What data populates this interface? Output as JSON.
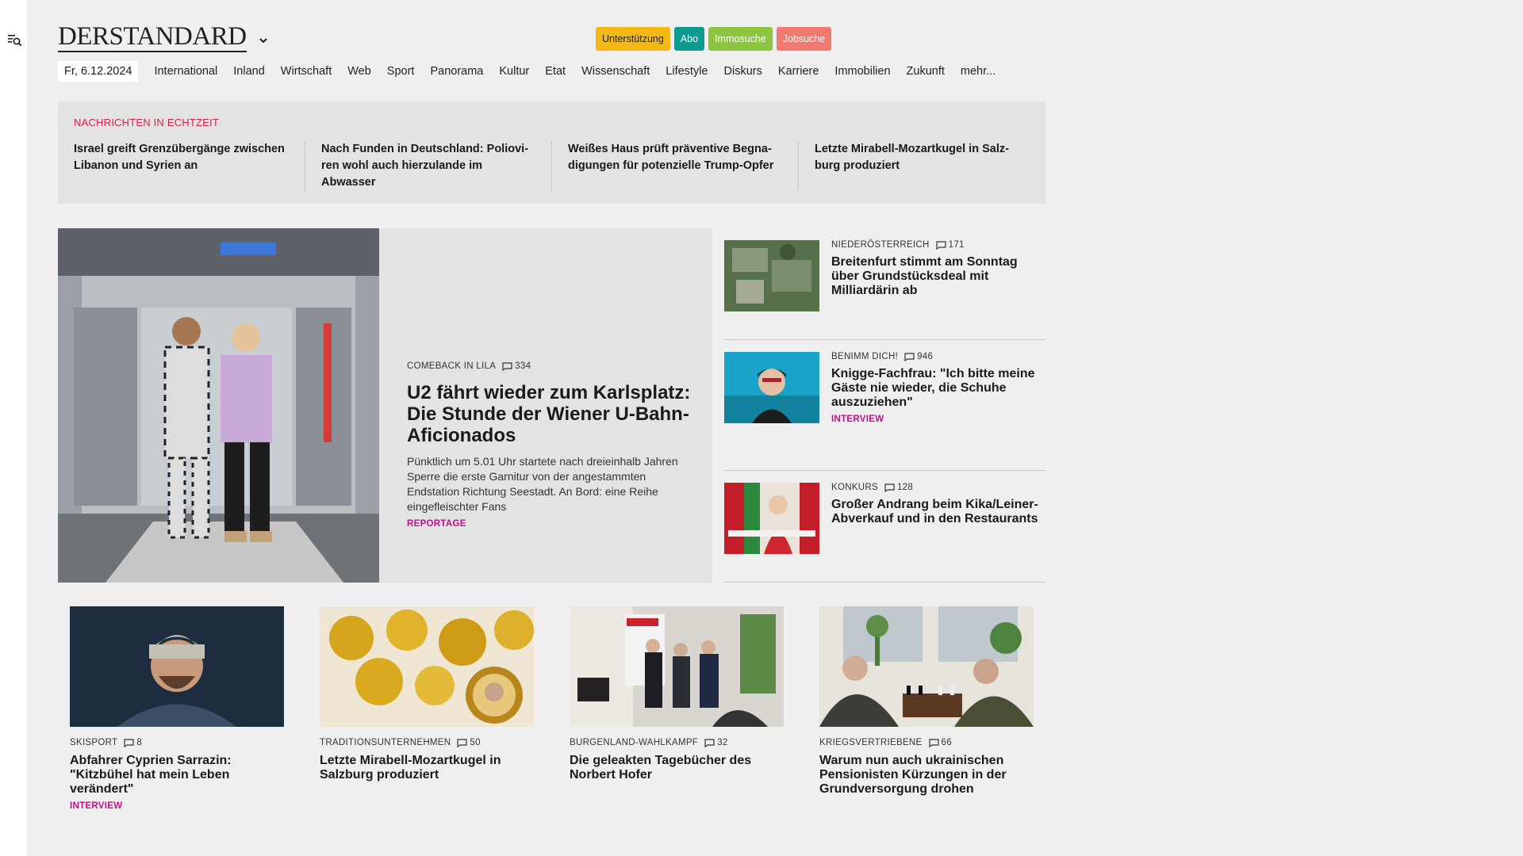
{
  "brand": {
    "logo": "DERSTANDARD"
  },
  "header_pills": [
    {
      "label": "Unterstützung",
      "bg": "#f5b915",
      "fg": "#222222"
    },
    {
      "label": "Abo",
      "bg": "#0a9a8f",
      "fg": "#ffffff"
    },
    {
      "label": "Immosuche",
      "bg": "#8cc63f",
      "fg": "#ffffff"
    },
    {
      "label": "Jobsuche",
      "bg": "#f07a6f",
      "fg": "#ffffff"
    }
  ],
  "nav": {
    "date": "Fr, 6.12.2024",
    "items": [
      "International",
      "Inland",
      "Wirtschaft",
      "Web",
      "Sport",
      "Panorama",
      "Kultur",
      "Etat",
      "Wissenschaft",
      "Lifestyle",
      "Diskurs",
      "Karriere",
      "Immobilien",
      "Zukunft",
      "mehr..."
    ]
  },
  "ticker": {
    "title": "NACHRICHTEN IN ECHTZEIT",
    "items": [
      "Israel greift Grenzübergänge zwischen Libanon und Syrien an",
      "Nach Funden in Deutschland: Poliovi­ren wohl auch hierzulande im Abwasser",
      "Weißes Haus prüft präventive Begna­digungen für potenzielle Trump-Opfer",
      "Letzte Mirabell-Mozartkugel in Salz­burg produziert"
    ]
  },
  "hero": {
    "kicker": "COMEBACK IN LILA",
    "comments": "334",
    "title": "U2 fährt wieder zum Karlsplatz: Die Stunde der Wiener U-Bahn-Aficionados",
    "teaser": "Pünktlich um 5.01 Uhr startete nach dreieinhalb Jahren Sperre die erste Garnitur von der angestammten Endstation Richtung Seestadt. An Bord: eine Reihe eingefleischter Fans",
    "tag": "REPORTAGE"
  },
  "side_articles": [
    {
      "kicker": "NIEDERÖSTERREICH",
      "comments": "171",
      "title": "Breitenfurt stimmt am Sonntag über Grundstücksdeal mit Milliardärin ab",
      "tag": ""
    },
    {
      "kicker": "BENIMM DICH!",
      "comments": "946",
      "title": "Knigge-Fachfrau: \"Ich bitte meine Gäste nie wieder, die Schuhe auszuziehen\"",
      "tag": "INTERVIEW"
    },
    {
      "kicker": "KONKURS",
      "comments": "128",
      "title": "Großer Andrang beim Kika/Leiner-Abverkauf und in den Restaurants",
      "tag": ""
    }
  ],
  "cards": [
    {
      "kicker": "SKISPORT",
      "comments": "8",
      "title": "Abfahrer Cyprien Sarrazin: \"Kitzbühel hat mein Leben verändert\"",
      "tag": "INTERVIEW"
    },
    {
      "kicker": "TRADITIONSUNTERNEHMEN",
      "comments": "50",
      "title": "Letzte Mirabell-Mozartkugel in Salzburg produziert",
      "tag": ""
    },
    {
      "kicker": "BURGENLAND-WAHLKAMPF",
      "comments": "32",
      "title": "Die geleakten Tagebücher des Norbert Hofer",
      "tag": ""
    },
    {
      "kicker": "KRIEGSVERTRIEBENE",
      "comments": "66",
      "title": "Warum nun auch ukrainischen Pensionisten Kürzungen in der Grundversorgung drohen",
      "tag": ""
    }
  ],
  "icons": {
    "menu": "menu-search-icon",
    "chevron": "chevron-down-icon",
    "comment": "comment-icon"
  },
  "colors": {
    "ticker_title": "#d3234b",
    "tag": "#c0128c",
    "background": "#efefef"
  }
}
